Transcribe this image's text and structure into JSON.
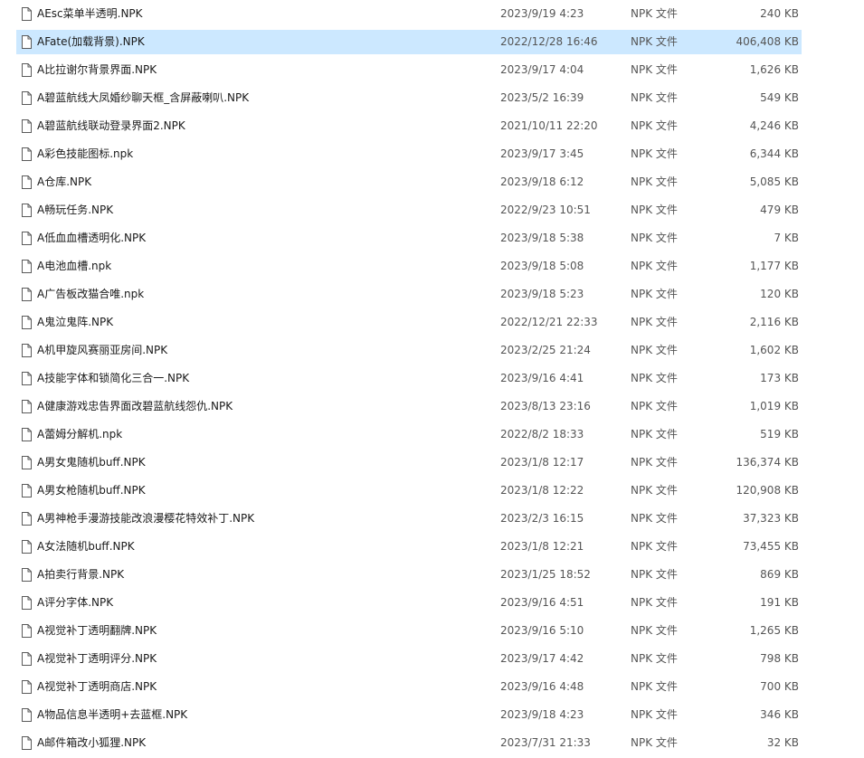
{
  "file_list": {
    "selected_index": 1,
    "rows": [
      {
        "name": "AEsc菜单半透明.NPK",
        "date": "2023/9/19 4:23",
        "type": "NPK 文件",
        "size": "240 KB"
      },
      {
        "name": "AFate(加载背景).NPK",
        "date": "2022/12/28 16:46",
        "type": "NPK 文件",
        "size": "406,408 KB"
      },
      {
        "name": "A比拉谢尔背景界面.NPK",
        "date": "2023/9/17 4:04",
        "type": "NPK 文件",
        "size": "1,626 KB"
      },
      {
        "name": "A碧蓝航线大凤婚纱聊天框_含屏蔽喇叭.NPK",
        "date": "2023/5/2 16:39",
        "type": "NPK 文件",
        "size": "549 KB"
      },
      {
        "name": "A碧蓝航线联动登录界面2.NPK",
        "date": "2021/10/11 22:20",
        "type": "NPK 文件",
        "size": "4,246 KB"
      },
      {
        "name": "A彩色技能图标.npk",
        "date": "2023/9/17 3:45",
        "type": "NPK 文件",
        "size": "6,344 KB"
      },
      {
        "name": "A仓库.NPK",
        "date": "2023/9/18 6:12",
        "type": "NPK 文件",
        "size": "5,085 KB"
      },
      {
        "name": "A畅玩任务.NPK",
        "date": "2022/9/23 10:51",
        "type": "NPK 文件",
        "size": "479 KB"
      },
      {
        "name": "A低血血槽透明化.NPK",
        "date": "2023/9/18 5:38",
        "type": "NPK 文件",
        "size": "7 KB"
      },
      {
        "name": "A电池血槽.npk",
        "date": "2023/9/18 5:08",
        "type": "NPK 文件",
        "size": "1,177 KB"
      },
      {
        "name": "A广告板改猫合唯.npk",
        "date": "2023/9/18 5:23",
        "type": "NPK 文件",
        "size": "120 KB"
      },
      {
        "name": "A鬼泣鬼阵.NPK",
        "date": "2022/12/21 22:33",
        "type": "NPK 文件",
        "size": "2,116 KB"
      },
      {
        "name": "A机甲旋风赛丽亚房间.NPK",
        "date": "2023/2/25 21:24",
        "type": "NPK 文件",
        "size": "1,602 KB"
      },
      {
        "name": "A技能字体和锁简化三合一.NPK",
        "date": "2023/9/16 4:41",
        "type": "NPK 文件",
        "size": "173 KB"
      },
      {
        "name": "A健康游戏忠告界面改碧蓝航线怨仇.NPK",
        "date": "2023/8/13 23:16",
        "type": "NPK 文件",
        "size": "1,019 KB"
      },
      {
        "name": "A蕾姆分解机.npk",
        "date": "2022/8/2 18:33",
        "type": "NPK 文件",
        "size": "519 KB"
      },
      {
        "name": "A男女鬼随机buff.NPK",
        "date": "2023/1/8 12:17",
        "type": "NPK 文件",
        "size": "136,374 KB"
      },
      {
        "name": "A男女枪随机buff.NPK",
        "date": "2023/1/8 12:22",
        "type": "NPK 文件",
        "size": "120,908 KB"
      },
      {
        "name": "A男神枪手漫游技能改浪漫樱花特效补丁.NPK",
        "date": "2023/2/3 16:15",
        "type": "NPK 文件",
        "size": "37,323 KB"
      },
      {
        "name": "A女法随机buff.NPK",
        "date": "2023/1/8 12:21",
        "type": "NPK 文件",
        "size": "73,455 KB"
      },
      {
        "name": "A拍卖行背景.NPK",
        "date": "2023/1/25 18:52",
        "type": "NPK 文件",
        "size": "869 KB"
      },
      {
        "name": "A评分字体.NPK",
        "date": "2023/9/16 4:51",
        "type": "NPK 文件",
        "size": "191 KB"
      },
      {
        "name": "A视觉补丁透明翻牌.NPK",
        "date": "2023/9/16 5:10",
        "type": "NPK 文件",
        "size": "1,265 KB"
      },
      {
        "name": "A视觉补丁透明评分.NPK",
        "date": "2023/9/17 4:42",
        "type": "NPK 文件",
        "size": "798 KB"
      },
      {
        "name": "A视觉补丁透明商店.NPK",
        "date": "2023/9/16 4:48",
        "type": "NPK 文件",
        "size": "700 KB"
      },
      {
        "name": "A物品信息半透明+去蓝框.NPK",
        "date": "2023/9/18 4:23",
        "type": "NPK 文件",
        "size": "346 KB"
      },
      {
        "name": "A邮件箱改小狐狸.NPK",
        "date": "2023/7/31 21:33",
        "type": "NPK 文件",
        "size": "32 KB"
      }
    ]
  }
}
